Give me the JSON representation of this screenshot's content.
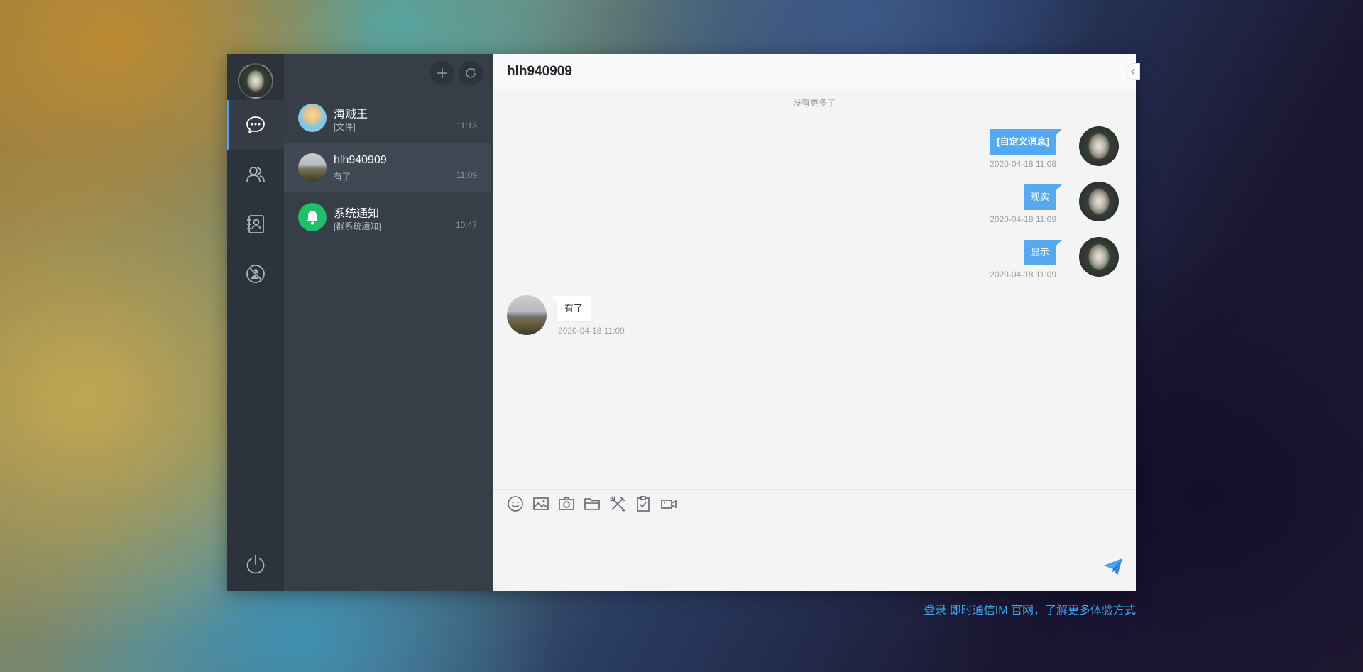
{
  "sidebar": {
    "nav": [
      {
        "name": "messages",
        "icon": "chat-bubble-icon",
        "active": true
      },
      {
        "name": "contacts",
        "icon": "users-icon",
        "active": false
      },
      {
        "name": "address-book",
        "icon": "address-book-icon",
        "active": false
      },
      {
        "name": "blacklist",
        "icon": "blocked-user-icon",
        "active": false
      }
    ],
    "power_icon": "power-icon"
  },
  "conversations": [
    {
      "name": "海贼王",
      "preview": "[文件]",
      "time": "11:13",
      "avatar": "cartoon-avatar"
    },
    {
      "name": "hlh940909",
      "preview": "有了",
      "time": "11:09",
      "avatar": "landscape-avatar",
      "selected": true
    },
    {
      "name": "系统通知",
      "preview": "[群系统通知]",
      "time": "10:47",
      "avatar": "bell-icon"
    }
  ],
  "chat": {
    "title": "hlh940909",
    "no_more": "没有更多了",
    "messages": [
      {
        "from": "self",
        "text": "[自定义消息]",
        "time": "2020-04-18 11:08"
      },
      {
        "from": "self",
        "text": "现实",
        "time": "2020-04-18 11:09"
      },
      {
        "from": "self",
        "text": "显示",
        "time": "2020-04-18 11:09"
      },
      {
        "from": "other",
        "text": "有了",
        "time": "2020-04-18 11:09"
      }
    ],
    "tools": [
      "emoji-icon",
      "image-icon",
      "camera-icon",
      "folder-icon",
      "tools-icon",
      "survey-icon",
      "video-icon"
    ],
    "send_icon": "send-icon"
  },
  "footer": {
    "text": "登录 即时通信IM 官网，了解更多体验方式"
  },
  "colors": {
    "accent": "#58a8f0",
    "rail_bg": "#2d333c",
    "list_bg": "#363e48",
    "link": "#3fa9f5"
  }
}
